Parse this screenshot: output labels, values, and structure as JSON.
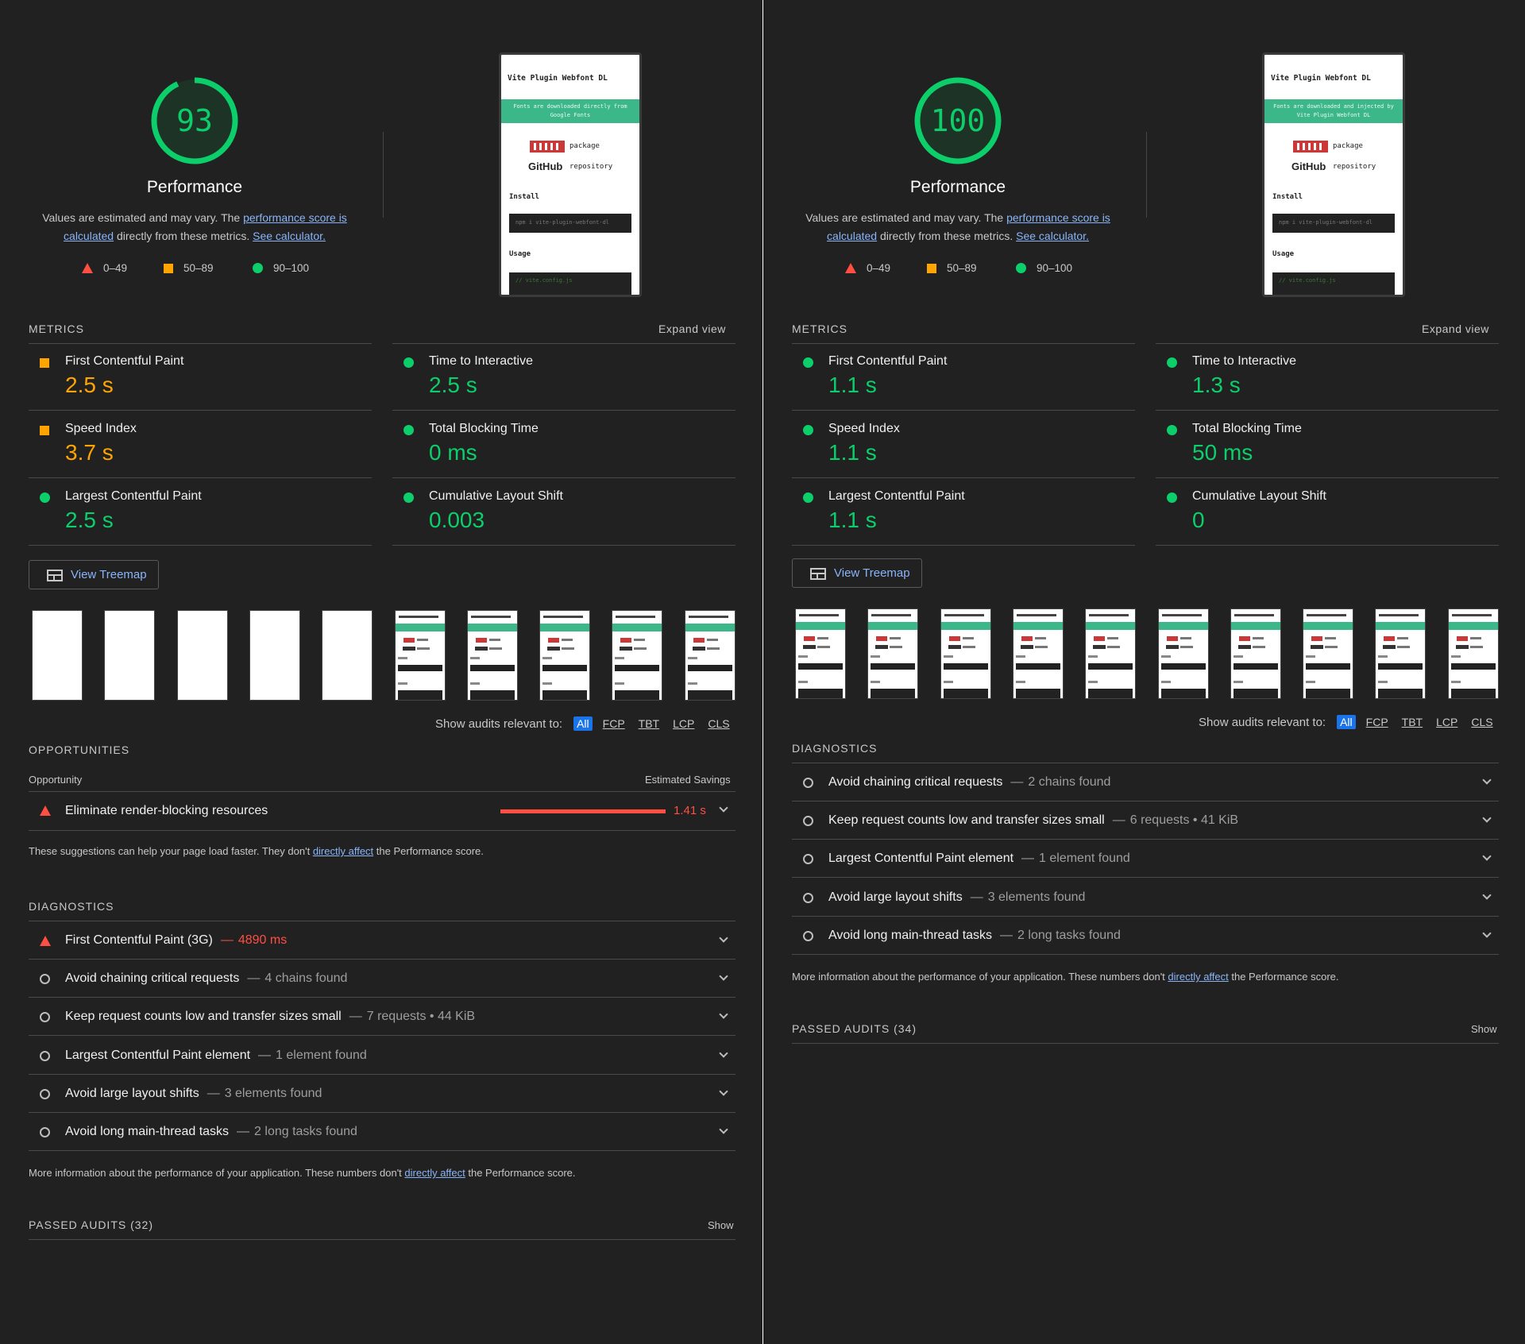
{
  "colors": {
    "pass": "#0cce6b",
    "average": "#ffa400",
    "fail": "#ff4e42",
    "link": "#8ab4f8",
    "accent": "#1a73e8",
    "background": "#212121"
  },
  "left": {
    "score": "93",
    "score_fraction": 0.93,
    "title": "Performance",
    "desc_pre": "Values are estimated and may vary. The ",
    "desc_link1": "performance score is calculated",
    "desc_mid": " directly from these metrics. ",
    "desc_link2": "See calculator.",
    "legend": [
      "0–49",
      "50–89",
      "90–100"
    ],
    "phone": {
      "title": "Vite Plugin Webfont DL",
      "banner": "Fonts are downloaded directly from Google Fonts",
      "package": "package",
      "github": "GitHub",
      "repository": "repository",
      "install": "Install",
      "cmd": "npm i vite-plugin-webfont-dl",
      "usage": "Usage",
      "config": "// vite.config.js"
    },
    "metrics_label": "METRICS",
    "expand_label": "Expand view",
    "metrics": [
      {
        "name": "First Contentful Paint",
        "value": "2.5 s",
        "status": "average"
      },
      {
        "name": "Time to Interactive",
        "value": "2.5 s",
        "status": "pass"
      },
      {
        "name": "Speed Index",
        "value": "3.7 s",
        "status": "average"
      },
      {
        "name": "Total Blocking Time",
        "value": "0 ms",
        "status": "pass"
      },
      {
        "name": "Largest Contentful Paint",
        "value": "2.5 s",
        "status": "pass"
      },
      {
        "name": "Cumulative Layout Shift",
        "value": "0.003",
        "status": "pass"
      }
    ],
    "treemap_label": "View Treemap",
    "filmstrip": [
      "blank",
      "blank",
      "blank",
      "blank",
      "blank",
      "shot",
      "shot",
      "shot",
      "shot",
      "shot"
    ],
    "filter_label": "Show audits relevant to:",
    "filters": [
      "All",
      "FCP",
      "TBT",
      "LCP",
      "CLS"
    ],
    "opportunities_label": "OPPORTUNITIES",
    "opp_col_left": "Opportunity",
    "opp_col_right": "Estimated Savings",
    "opportunity": {
      "name": "Eliminate render-blocking resources",
      "savings": "1.41 s"
    },
    "opp_note_pre": "These suggestions can help your page load faster. They don't ",
    "opp_note_link": "directly affect",
    "opp_note_post": " the Performance score.",
    "diagnostics_label": "DIAGNOSTICS",
    "diagnostics": [
      {
        "name": "First Contentful Paint (3G)",
        "detail": "4890 ms",
        "status": "fail"
      },
      {
        "name": "Avoid chaining critical requests",
        "detail": "4 chains found",
        "status": "info"
      },
      {
        "name": "Keep request counts low and transfer sizes small",
        "detail": "7 requests • 44 KiB",
        "status": "info"
      },
      {
        "name": "Largest Contentful Paint element",
        "detail": "1 element found",
        "status": "info"
      },
      {
        "name": "Avoid large layout shifts",
        "detail": "3 elements found",
        "status": "info"
      },
      {
        "name": "Avoid long main-thread tasks",
        "detail": "2 long tasks found",
        "status": "info"
      }
    ],
    "diag_note_pre": "More information about the performance of your application. These numbers don't ",
    "diag_note_link": "directly affect",
    "diag_note_post": " the Performance score.",
    "passed_label": "PASSED AUDITS (32)",
    "show_label": "Show"
  },
  "right": {
    "score": "100",
    "score_fraction": 1.0,
    "title": "Performance",
    "desc_pre": "Values are estimated and may vary. The ",
    "desc_link1": "performance score is calculated",
    "desc_mid": " directly from these metrics. ",
    "desc_link2": "See calculator.",
    "legend": [
      "0–49",
      "50–89",
      "90–100"
    ],
    "phone": {
      "title": "Vite Plugin Webfont DL",
      "banner": "Fonts are downloaded and injected by Vite Plugin Webfont DL",
      "package": "package",
      "github": "GitHub",
      "repository": "repository",
      "install": "Install",
      "cmd": "npm i vite-plugin-webfont-dl",
      "usage": "Usage",
      "config": "// vite.config.js"
    },
    "metrics_label": "METRICS",
    "expand_label": "Expand view",
    "metrics": [
      {
        "name": "First Contentful Paint",
        "value": "1.1 s",
        "status": "pass"
      },
      {
        "name": "Time to Interactive",
        "value": "1.3 s",
        "status": "pass"
      },
      {
        "name": "Speed Index",
        "value": "1.1 s",
        "status": "pass"
      },
      {
        "name": "Total Blocking Time",
        "value": "50 ms",
        "status": "pass"
      },
      {
        "name": "Largest Contentful Paint",
        "value": "1.1 s",
        "status": "pass"
      },
      {
        "name": "Cumulative Layout Shift",
        "value": "0",
        "status": "pass"
      }
    ],
    "treemap_label": "View Treemap",
    "filmstrip": [
      "shot",
      "shot",
      "shot",
      "shot",
      "shot",
      "shot",
      "shot",
      "shot",
      "shot",
      "shot"
    ],
    "filter_label": "Show audits relevant to:",
    "filters": [
      "All",
      "FCP",
      "TBT",
      "LCP",
      "CLS"
    ],
    "diagnostics_label": "DIAGNOSTICS",
    "diagnostics": [
      {
        "name": "Avoid chaining critical requests",
        "detail": "2 chains found",
        "status": "info"
      },
      {
        "name": "Keep request counts low and transfer sizes small",
        "detail": "6 requests • 41 KiB",
        "status": "info"
      },
      {
        "name": "Largest Contentful Paint element",
        "detail": "1 element found",
        "status": "info"
      },
      {
        "name": "Avoid large layout shifts",
        "detail": "3 elements found",
        "status": "info"
      },
      {
        "name": "Avoid long main-thread tasks",
        "detail": "2 long tasks found",
        "status": "info"
      }
    ],
    "diag_note_pre": "More information about the performance of your application. These numbers don't ",
    "diag_note_link": "directly affect",
    "diag_note_post": " the Performance score.",
    "passed_label": "PASSED AUDITS (34)",
    "show_label": "Show"
  }
}
